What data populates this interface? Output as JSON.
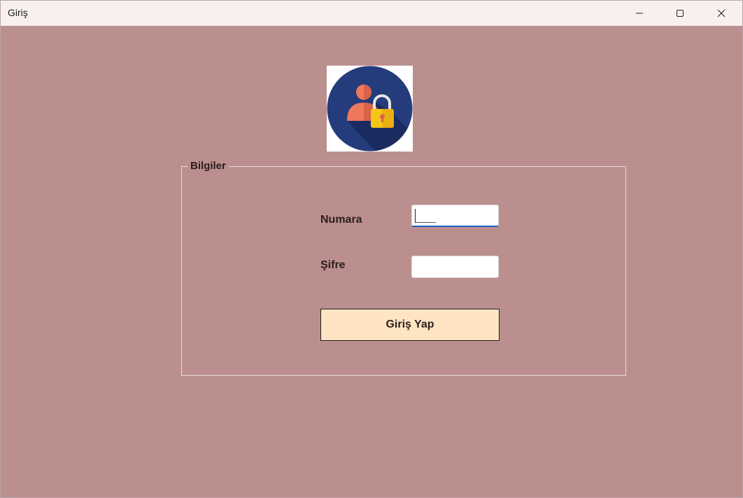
{
  "window": {
    "title": "Giriş",
    "background": "#bc8f8f",
    "controls": {
      "minimize_icon": "minimize-icon",
      "maximize_icon": "maximize-icon",
      "close_icon": "close-icon"
    }
  },
  "logo": {
    "icon": "user-lock-icon",
    "colors": {
      "circle": "#253c7c",
      "shadow": "#1b2b60",
      "person": "#f0785a",
      "lock": "#f5c518"
    }
  },
  "form": {
    "group_title": "Bilgiler",
    "numara_label": "Numara",
    "sifre_label": "Şifre",
    "numara_value": "",
    "sifre_value": "",
    "submit_label": "Giriş Yap",
    "submit_color": "#ffe4c4"
  }
}
